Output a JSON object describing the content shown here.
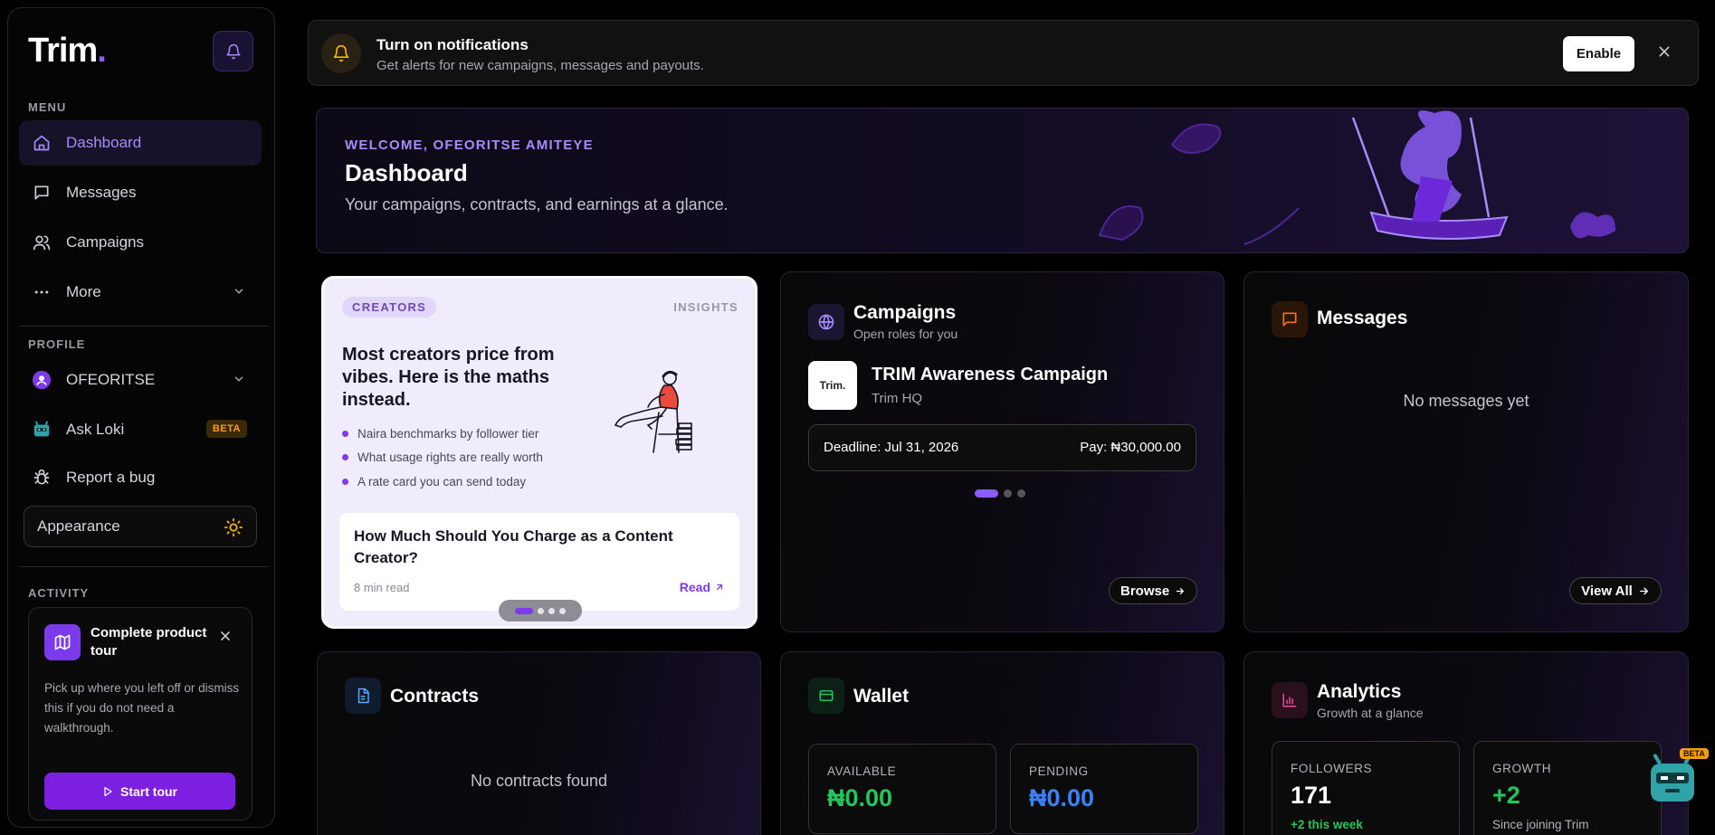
{
  "app": {
    "logo_text": "Trim",
    "logo_dot": "."
  },
  "sidebar": {
    "menu_label": "MENU",
    "items": [
      {
        "label": "Dashboard",
        "icon": "home-icon",
        "active": true
      },
      {
        "label": "Messages",
        "icon": "message-icon"
      },
      {
        "label": "Campaigns",
        "icon": "users-icon"
      },
      {
        "label": "More",
        "icon": "more-dots-icon"
      }
    ],
    "profile_label": "PROFILE",
    "profile_name": "OFEORITSE",
    "ask_loki": "Ask Loki",
    "beta": "BETA",
    "report_bug": "Report a bug",
    "appearance": "Appearance",
    "activity_label": "ACTIVITY",
    "tour": {
      "title": "Complete product tour",
      "description": "Pick up where you left off or dismiss this if you do not need a walkthrough.",
      "button": "Start tour"
    }
  },
  "notification": {
    "title": "Turn on notifications",
    "subtitle": "Get alerts for new campaigns, messages and payouts.",
    "enable": "Enable"
  },
  "welcome": {
    "kicker": "WELCOME, OFEORITSE AMITEYE",
    "title": "Dashboard",
    "subtitle": "Your campaigns, contracts, and earnings at a glance."
  },
  "insight": {
    "badge": "CREATORS",
    "tag": "INSIGHTS",
    "headline": "Most creators price from vibes. Here is the maths instead.",
    "bullets": [
      "Naira benchmarks by follower tier",
      "What usage rights are really worth",
      "A rate card you can send today"
    ],
    "article_title": "How Much Should You Charge as a Content Creator?",
    "read_time": "8 min read",
    "read": "Read"
  },
  "campaigns": {
    "title": "Campaigns",
    "subtitle": "Open roles for you",
    "item_logo": "Trim.",
    "item_title": "TRIM Awareness Campaign",
    "item_org": "Trim HQ",
    "deadline": "Deadline: Jul 31, 2026",
    "pay": "Pay: ₦30,000.00",
    "browse": "Browse"
  },
  "messages": {
    "title": "Messages",
    "empty": "No messages yet",
    "view_all": "View All"
  },
  "contracts": {
    "title": "Contracts",
    "empty": "No contracts found"
  },
  "wallet": {
    "title": "Wallet",
    "available_label": "AVAILABLE",
    "available": "₦0.00",
    "pending_label": "PENDING",
    "pending": "₦0.00"
  },
  "analytics": {
    "title": "Analytics",
    "subtitle": "Growth at a glance",
    "followers_label": "FOLLOWERS",
    "followers": "171",
    "followers_delta": "+2 this week",
    "growth_label": "GROWTH",
    "growth": "+2",
    "growth_note": "Since joining Trim",
    "loki_beta": "BETA"
  },
  "colors": {
    "accent": "#8b5cf6",
    "success": "#22c55e",
    "info": "#3b82f6",
    "warning": "#f59e0b"
  }
}
